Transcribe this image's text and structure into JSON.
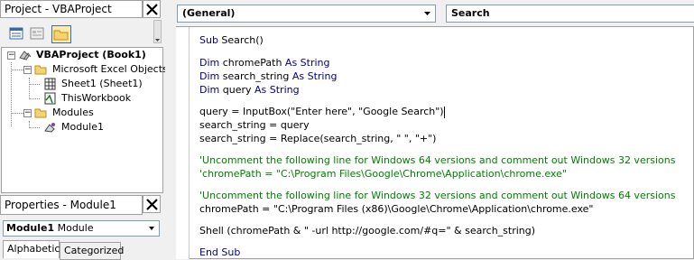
{
  "project_panel": {
    "title": "Project - VBAProject",
    "tree": {
      "root": "VBAProject (Book1)",
      "folder_objects": "Microsoft Excel Objects",
      "sheet1": "Sheet1 (Sheet1)",
      "thisworkbook": "ThisWorkbook",
      "folder_modules": "Modules",
      "module1": "Module1"
    }
  },
  "properties_panel": {
    "title": "Properties - Module1",
    "object_name": "Module1",
    "object_type": "Module",
    "tabs": [
      "Alphabetic",
      "Categorized"
    ]
  },
  "editor": {
    "object_combo": "(General)",
    "proc_combo": "Search",
    "lines": [
      {
        "kind": "sig",
        "kw": "Sub",
        "text": " Search()"
      },
      {
        "kind": "dim",
        "kw": "Dim",
        "name": " chromePath ",
        "as": "As String"
      },
      {
        "kind": "dim",
        "kw": "Dim",
        "name": " search_string ",
        "as": "As String"
      },
      {
        "kind": "dim",
        "kw": "Dim",
        "name": " query ",
        "as": "As String"
      },
      {
        "kind": "plain",
        "text": "query = InputBox(\"Enter here\", \"Google Search\")"
      },
      {
        "kind": "plain",
        "text": "search_string = query"
      },
      {
        "kind": "plain",
        "text": "search_string = Replace(search_string, \" \", \"+\")"
      },
      {
        "kind": "comment",
        "text": "'Uncomment the following line for Windows 64 versions and comment out Windows 32 versions"
      },
      {
        "kind": "comment",
        "text": "'chromePath = \"C:\\Program Files\\Google\\Chrome\\Application\\chrome.exe\""
      },
      {
        "kind": "comment",
        "text": "'Uncomment the following line for Windows 32 versions and comment out Windows 64 versions"
      },
      {
        "kind": "plain",
        "text": "chromePath = \"C:\\Program Files (x86)\\Google\\Chrome\\Application\\chrome.exe\""
      },
      {
        "kind": "plain",
        "text": "Shell (chromePath & \" -url http://google.com/#q=\" & search_string)"
      },
      {
        "kind": "end",
        "kw": "End Sub"
      }
    ]
  }
}
